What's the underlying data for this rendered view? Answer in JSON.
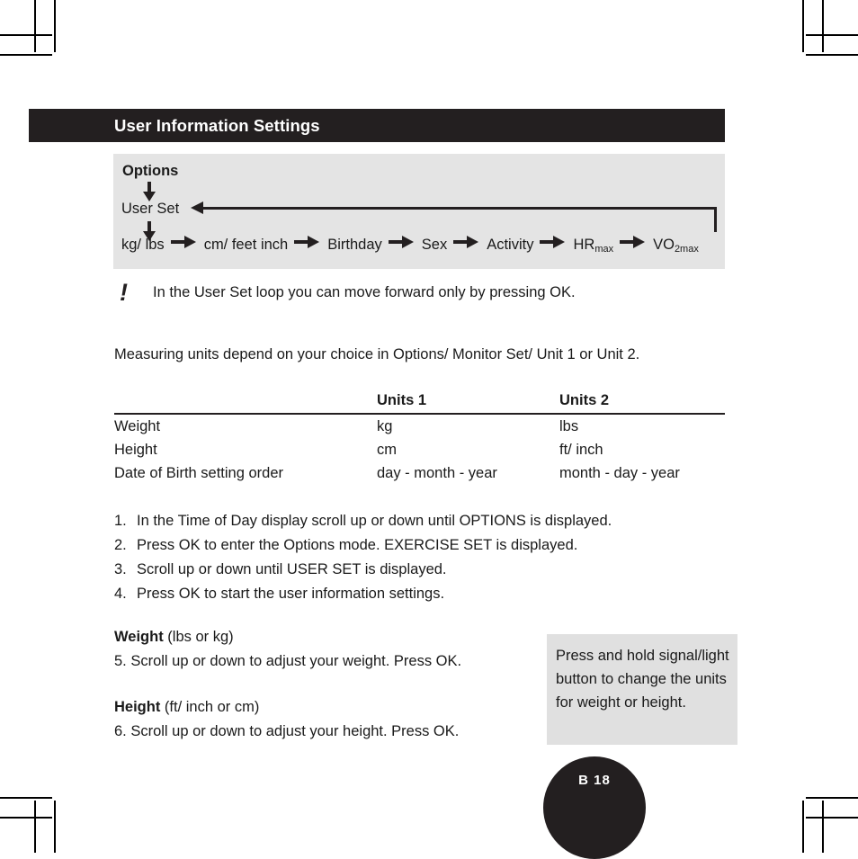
{
  "header": {
    "title": "User Information Settings"
  },
  "diagram": {
    "title": "Options",
    "root_node": "User Set",
    "loop_note_icon": "exclamation-icon",
    "chain": [
      {
        "label": "kg/ lbs",
        "sub": ""
      },
      {
        "label": "cm/ feet inch",
        "sub": ""
      },
      {
        "label": "Birthday",
        "sub": ""
      },
      {
        "label": "Sex",
        "sub": ""
      },
      {
        "label": "Activity",
        "sub": ""
      },
      {
        "label": "HR",
        "sub": "max"
      },
      {
        "label": "VO",
        "sub": "2max"
      }
    ]
  },
  "note": {
    "icon": "exclamation-icon",
    "text": "In the User Set loop you can move forward only by pressing OK."
  },
  "intro": "Measuring units depend on your choice in Options/ Monitor Set/ Unit 1 or Unit 2.",
  "units_table": {
    "headers": [
      "",
      "Units 1",
      "Units 2"
    ],
    "rows": [
      [
        "Weight",
        "kg",
        "lbs"
      ],
      [
        "Height",
        "cm",
        "ft/ inch"
      ],
      [
        "Date of Birth setting order",
        "day - month - year",
        "month - day - year"
      ]
    ]
  },
  "steps": [
    {
      "num": "1.",
      "text": "In the Time of Day display scroll up or down until OPTIONS is displayed."
    },
    {
      "num": "2.",
      "text": "Press OK to enter the Options mode. EXERCISE SET is displayed."
    },
    {
      "num": "3.",
      "text": "Scroll up or down until USER SET is displayed."
    },
    {
      "num": "4.",
      "text": "Press OK to start the user information settings."
    }
  ],
  "weight_block": {
    "heading_bold": "Weight",
    "heading_rest": " (lbs or kg)",
    "step": "5.  Scroll up or down to adjust your weight. Press OK."
  },
  "height_block": {
    "heading_bold": "Height",
    "heading_rest": " (ft/ inch or cm)",
    "step": "6.  Scroll up or down to adjust your height. Press OK."
  },
  "callout": {
    "text": "Press and hold signal/light button to change the units for weight or height."
  },
  "page_badge": {
    "label": "B 18"
  },
  "colors": {
    "header_bar": "#231f20",
    "diagram_panel": "#e4e4e4",
    "callout_panel": "#e0e0e0",
    "text": "#1a1a1a",
    "page_badge": "#231f20"
  }
}
